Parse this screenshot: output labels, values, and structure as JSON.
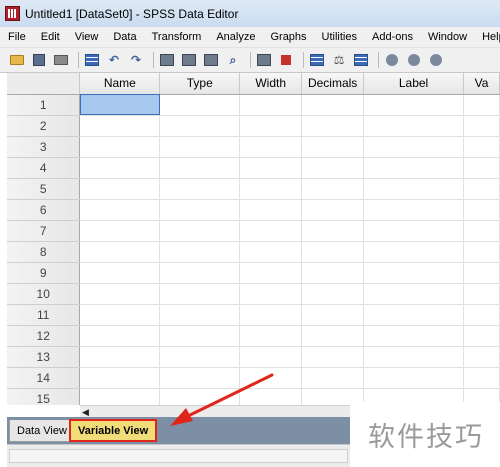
{
  "window": {
    "title": "Untitled1 [DataSet0] - SPSS Data Editor"
  },
  "menu": [
    "File",
    "Edit",
    "View",
    "Data",
    "Transform",
    "Analyze",
    "Graphs",
    "Utilities",
    "Add-ons",
    "Window",
    "Help"
  ],
  "toolbar": {
    "icons": [
      "open-folder-icon",
      "save-icon",
      "print-icon",
      "dialog-recall-icon",
      "undo-icon",
      "redo-icon",
      "goto-case-icon",
      "goto-variable-icon",
      "variables-icon",
      "find-icon",
      "insert-cases-icon",
      "insert-variable-icon",
      "split-file-icon",
      "weight-cases-icon",
      "select-cases-icon",
      "value-labels-icon",
      "use-sets-icon",
      "show-all-icon"
    ]
  },
  "grid": {
    "columns": [
      "Name",
      "Type",
      "Width",
      "Decimals",
      "Label",
      "Va"
    ],
    "rows": [
      "1",
      "2",
      "3",
      "4",
      "5",
      "6",
      "7",
      "8",
      "9",
      "10",
      "11",
      "12",
      "13",
      "14",
      "15"
    ]
  },
  "tabs": {
    "data_view": "Data View",
    "variable_view": "Variable View"
  },
  "watermark": "软件技巧",
  "colors": {
    "highlight": "#e0251b",
    "selected_cell": "#a6c8ee",
    "active_tab": "#f1dc7a"
  }
}
